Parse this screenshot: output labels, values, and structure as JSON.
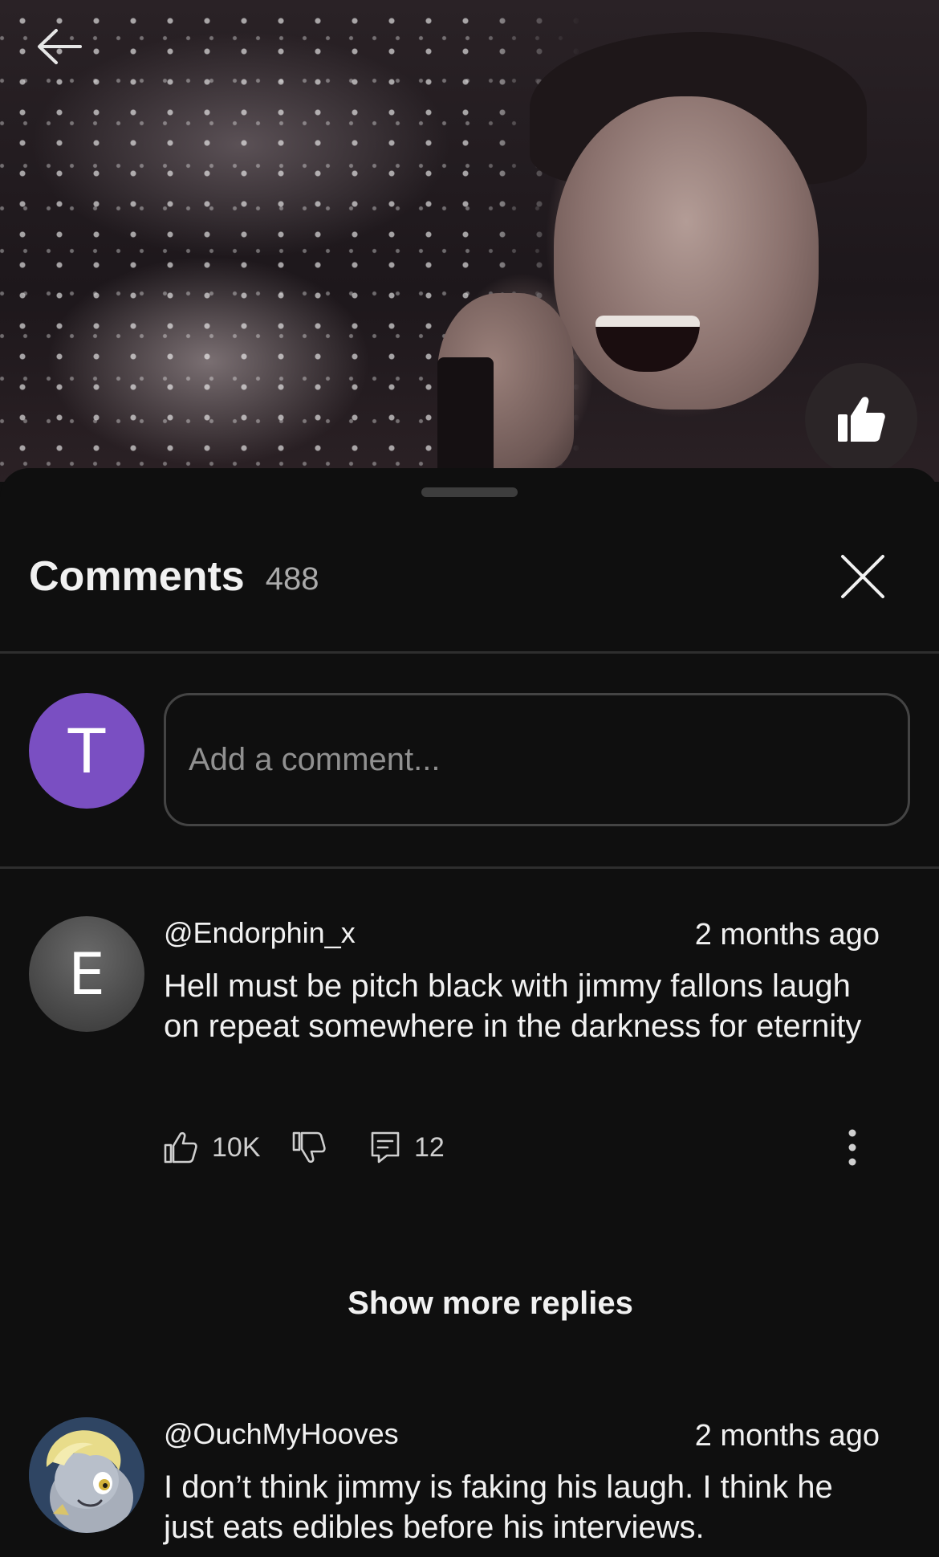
{
  "video": {
    "back_icon": "arrow-left-icon",
    "like_icon": "thumb-up-filled-icon"
  },
  "sheet": {
    "title": "Comments",
    "count": "488",
    "close_icon": "close-icon"
  },
  "composer": {
    "avatar_letter": "T",
    "avatar_color": "#7a4fc2",
    "placeholder": "Add a comment..."
  },
  "comments": [
    {
      "avatar_letter": "E",
      "author": "@Endorphin_x",
      "time": "2 months ago",
      "text": "Hell must be pitch black with jimmy fallons laugh on repeat somewhere in the darkness for eternity",
      "likes": "10K",
      "replies": "12",
      "show_more_label": "Show more replies"
    },
    {
      "author": "@OuchMyHooves",
      "time": "2 months ago",
      "text": "I don’t think jimmy is faking his laugh. I think he just eats edibles before his interviews."
    }
  ]
}
